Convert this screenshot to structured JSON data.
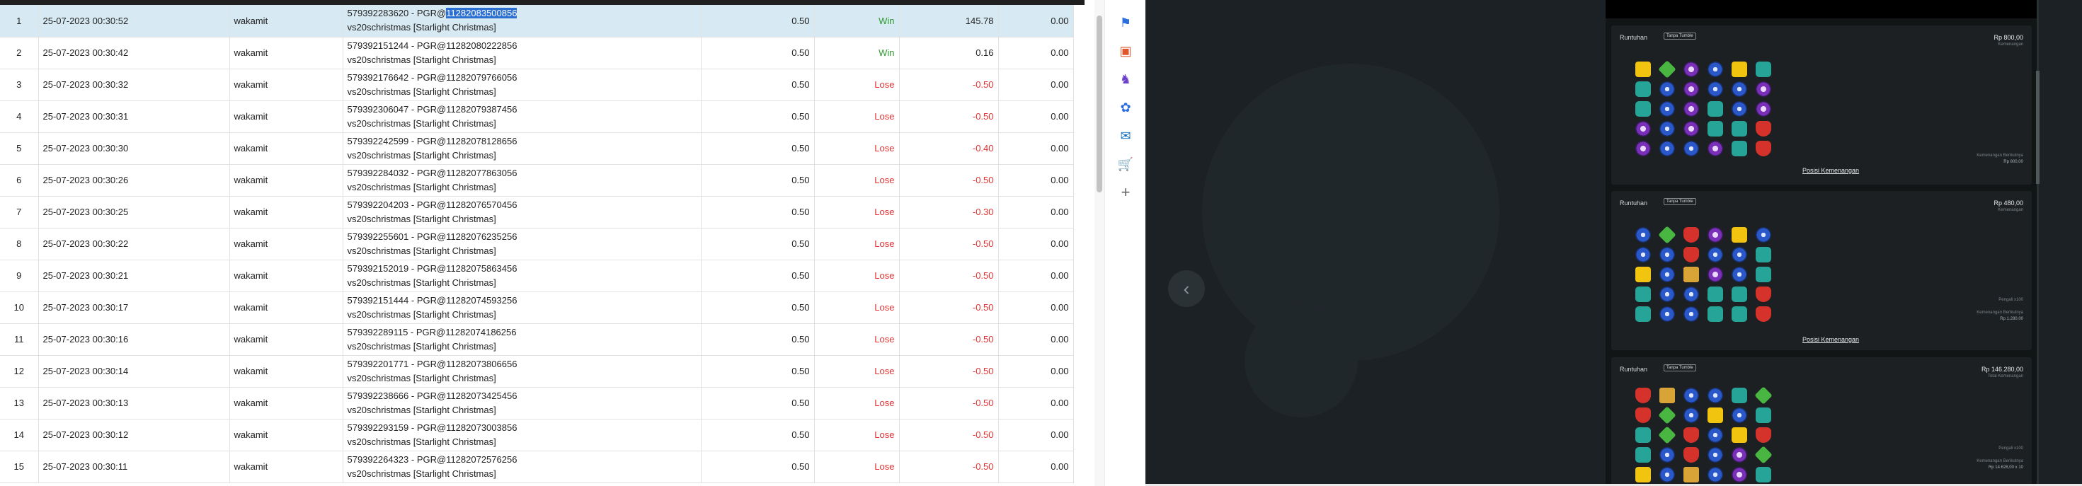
{
  "bets": [
    {
      "no": "1",
      "time": "25-07-2023 00:30:52",
      "user": "wakamit",
      "id_pre": "579392283620 - PGR@",
      "id_hl": "11282083500856",
      "id_post": "",
      "game": "vs20schristmas [Starlight Christmas]",
      "stake": "0.50",
      "result": "Win",
      "payout": "145.78",
      "extra": "0.00"
    },
    {
      "no": "2",
      "time": "25-07-2023 00:30:42",
      "user": "wakamit",
      "id_pre": "579392151244 - PGR@11282080222856",
      "id_hl": "",
      "id_post": "",
      "game": "vs20schristmas [Starlight Christmas]",
      "stake": "0.50",
      "result": "Win",
      "payout": "0.16",
      "extra": "0.00"
    },
    {
      "no": "3",
      "time": "25-07-2023 00:30:32",
      "user": "wakamit",
      "id_pre": "579392176642 - PGR@11282079766056",
      "id_hl": "",
      "id_post": "",
      "game": "vs20schristmas [Starlight Christmas]",
      "stake": "0.50",
      "result": "Lose",
      "payout": "-0.50",
      "extra": "0.00"
    },
    {
      "no": "4",
      "time": "25-07-2023 00:30:31",
      "user": "wakamit",
      "id_pre": "579392306047 - PGR@11282079387456",
      "id_hl": "",
      "id_post": "",
      "game": "vs20schristmas [Starlight Christmas]",
      "stake": "0.50",
      "result": "Lose",
      "payout": "-0.50",
      "extra": "0.00"
    },
    {
      "no": "5",
      "time": "25-07-2023 00:30:30",
      "user": "wakamit",
      "id_pre": "579392242599 - PGR@11282078128656",
      "id_hl": "",
      "id_post": "",
      "game": "vs20schristmas [Starlight Christmas]",
      "stake": "0.50",
      "result": "Lose",
      "payout": "-0.40",
      "extra": "0.00"
    },
    {
      "no": "6",
      "time": "25-07-2023 00:30:26",
      "user": "wakamit",
      "id_pre": "579392284032 - PGR@11282077863056",
      "id_hl": "",
      "id_post": "",
      "game": "vs20schristmas [Starlight Christmas]",
      "stake": "0.50",
      "result": "Lose",
      "payout": "-0.50",
      "extra": "0.00"
    },
    {
      "no": "7",
      "time": "25-07-2023 00:30:25",
      "user": "wakamit",
      "id_pre": "579392204203 - PGR@11282076570456",
      "id_hl": "",
      "id_post": "",
      "game": "vs20schristmas [Starlight Christmas]",
      "stake": "0.50",
      "result": "Lose",
      "payout": "-0.30",
      "extra": "0.00"
    },
    {
      "no": "8",
      "time": "25-07-2023 00:30:22",
      "user": "wakamit",
      "id_pre": "579392255601 - PGR@11282076235256",
      "id_hl": "",
      "id_post": "",
      "game": "vs20schristmas [Starlight Christmas]",
      "stake": "0.50",
      "result": "Lose",
      "payout": "-0.50",
      "extra": "0.00"
    },
    {
      "no": "9",
      "time": "25-07-2023 00:30:21",
      "user": "wakamit",
      "id_pre": "579392152019 - PGR@11282075863456",
      "id_hl": "",
      "id_post": "",
      "game": "vs20schristmas [Starlight Christmas]",
      "stake": "0.50",
      "result": "Lose",
      "payout": "-0.50",
      "extra": "0.00"
    },
    {
      "no": "10",
      "time": "25-07-2023 00:30:17",
      "user": "wakamit",
      "id_pre": "579392151444 - PGR@11282074593256",
      "id_hl": "",
      "id_post": "",
      "game": "vs20schristmas [Starlight Christmas]",
      "stake": "0.50",
      "result": "Lose",
      "payout": "-0.50",
      "extra": "0.00"
    },
    {
      "no": "11",
      "time": "25-07-2023 00:30:16",
      "user": "wakamit",
      "id_pre": "579392289115 - PGR@11282074186256",
      "id_hl": "",
      "id_post": "",
      "game": "vs20schristmas [Starlight Christmas]",
      "stake": "0.50",
      "result": "Lose",
      "payout": "-0.50",
      "extra": "0.00"
    },
    {
      "no": "12",
      "time": "25-07-2023 00:30:14",
      "user": "wakamit",
      "id_pre": "579392201771 - PGR@11282073806656",
      "id_hl": "",
      "id_post": "",
      "game": "vs20schristmas [Starlight Christmas]",
      "stake": "0.50",
      "result": "Lose",
      "payout": "-0.50",
      "extra": "0.00"
    },
    {
      "no": "13",
      "time": "25-07-2023 00:30:13",
      "user": "wakamit",
      "id_pre": "579392238666 - PGR@11282073425456",
      "id_hl": "",
      "id_post": "",
      "game": "vs20schristmas [Starlight Christmas]",
      "stake": "0.50",
      "result": "Lose",
      "payout": "-0.50",
      "extra": "0.00"
    },
    {
      "no": "14",
      "time": "25-07-2023 00:30:12",
      "user": "wakamit",
      "id_pre": "579392293159 - PGR@11282073003856",
      "id_hl": "",
      "id_post": "",
      "game": "vs20schristmas [Starlight Christmas]",
      "stake": "0.50",
      "result": "Lose",
      "payout": "-0.50",
      "extra": "0.00"
    },
    {
      "no": "15",
      "time": "25-07-2023 00:30:11",
      "user": "wakamit",
      "id_pre": "579392264323 - PGR@11282072576256",
      "id_hl": "",
      "id_post": "",
      "game": "vs20schristmas [Starlight Christmas]",
      "stake": "0.50",
      "result": "Lose",
      "payout": "-0.50",
      "extra": "0.00"
    }
  ],
  "sidebar_icons": [
    "tag-icon",
    "toolbox-icon",
    "chess-icon",
    "copilot-icon",
    "outlook-icon",
    "shopping-cart-icon",
    "plus-icon"
  ],
  "game_panel": {
    "cards": [
      {
        "title": "Runtuhan",
        "badge": "Tanpa Tumble",
        "amount": "Rp 800,00",
        "amount_sub": "Kemenangan",
        "link": "Posisi Kemenangan",
        "note_label": "Kemenangan Berikutnya",
        "note_value": "Rp 800,00",
        "grid": [
          [
            "yellow",
            "green",
            "purple",
            "blue",
            "yellow",
            "teal"
          ],
          [
            "teal",
            "blue",
            "purple",
            "blue",
            "blue",
            "purple"
          ],
          [
            "teal",
            "blue",
            "purple",
            "teal",
            "blue",
            "purple"
          ],
          [
            "purple",
            "blue",
            "purple",
            "teal",
            "teal",
            "red"
          ],
          [
            "purple",
            "blue",
            "blue",
            "purple",
            "teal",
            "red"
          ]
        ]
      },
      {
        "title": "Runtuhan",
        "badge": "Tanpa Tumble",
        "amount": "Rp 480,00",
        "amount_sub": "Kemenangan",
        "link": "Posisi Kemenangan",
        "note_label": "Kemenangan Berikutnya",
        "note_value": "Rp 1.280,00",
        "note_top": "Pengali x100",
        "grid": [
          [
            "blue",
            "green",
            "red",
            "purple",
            "yellow",
            "blue"
          ],
          [
            "blue",
            "blue",
            "red",
            "blue",
            "blue",
            "teal"
          ],
          [
            "yellow",
            "blue",
            "crown",
            "purple",
            "blue",
            "teal"
          ],
          [
            "teal",
            "blue",
            "blue",
            "teal",
            "teal",
            "red"
          ],
          [
            "teal",
            "blue",
            "blue",
            "teal",
            "teal",
            "red"
          ]
        ]
      },
      {
        "title": "Runtuhan",
        "badge": "Tanpa Tumble",
        "amount": "Rp 146.280,00",
        "amount_sub": "Total Kemenangan",
        "note_label": "Kemenangan Berikutnya",
        "note_value": "Rp 14.628,00 x 10",
        "note_top": "Pengali x100",
        "grid": [
          [
            "red",
            "crown",
            "blue",
            "blue",
            "teal",
            "green"
          ],
          [
            "red",
            "green",
            "blue",
            "yellow",
            "blue",
            "teal"
          ],
          [
            "teal",
            "green",
            "red",
            "blue",
            "yellow",
            "red"
          ],
          [
            "teal",
            "blue",
            "red",
            "blue",
            "purple",
            "green"
          ],
          [
            "yellow",
            "blue",
            "crown",
            "blue",
            "purple",
            "teal"
          ]
        ]
      }
    ]
  },
  "colors": {
    "win": "#2e9a2e",
    "lose": "#e23333",
    "selected_row": "#d7e9f2",
    "highlight": "#2a6fd1",
    "game_bg": "#1b2125"
  }
}
